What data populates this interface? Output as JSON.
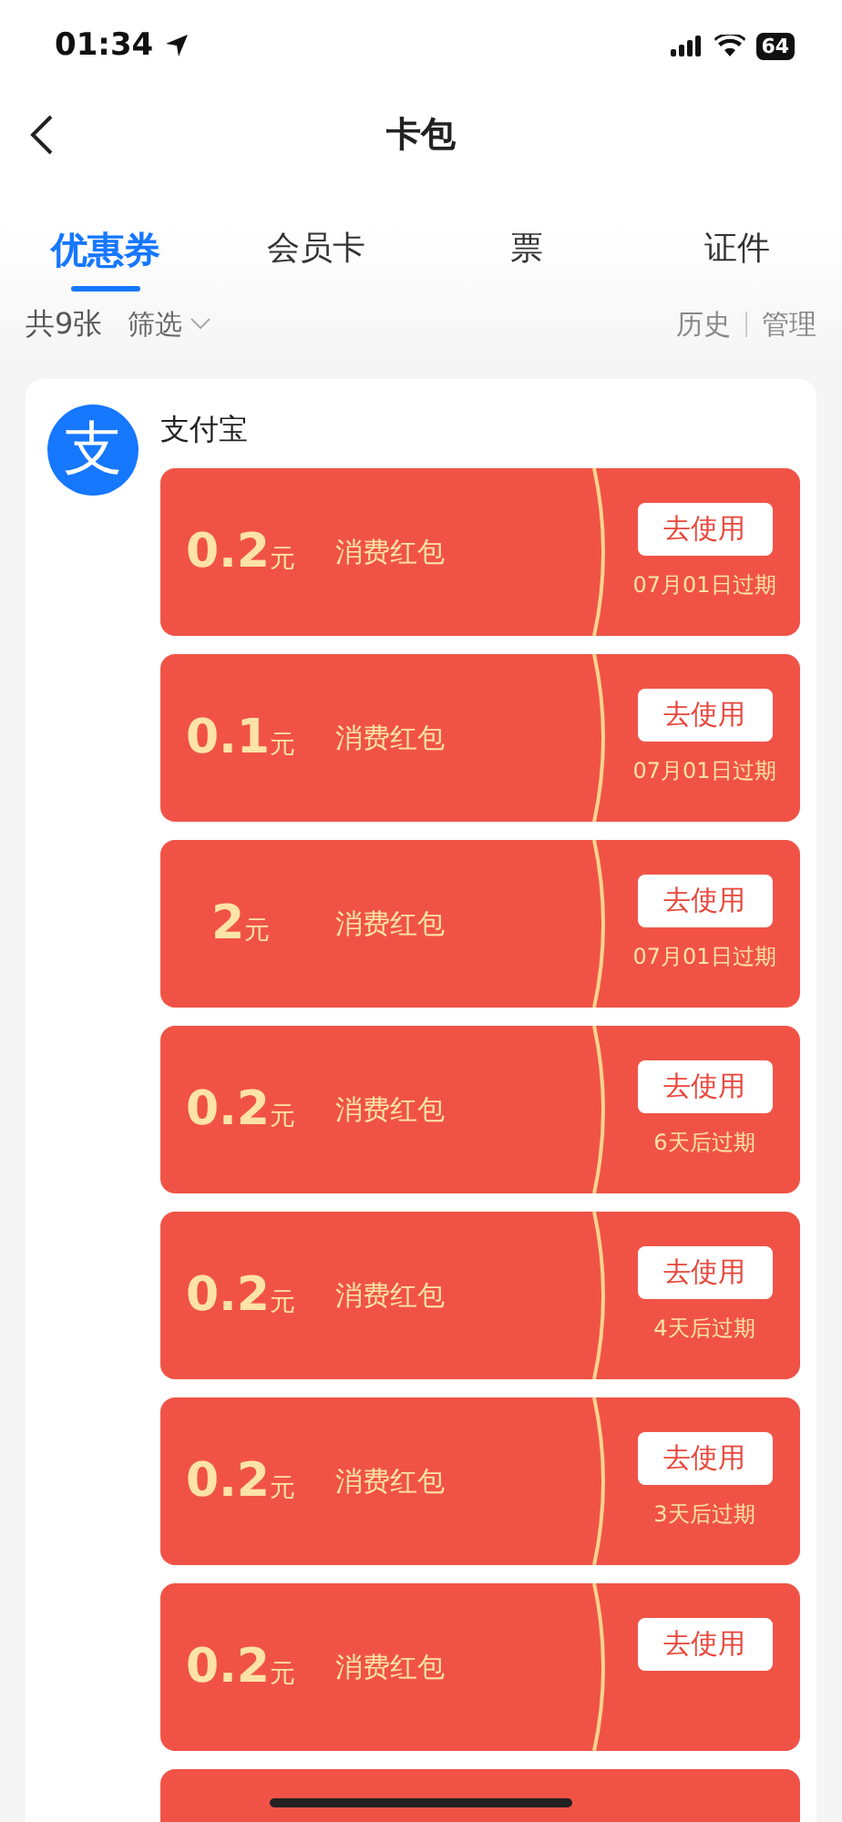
{
  "status_bar": {
    "time": "01:34",
    "battery": "64"
  },
  "header": {
    "title": "卡包"
  },
  "tabs": [
    {
      "label": "优惠券",
      "selected": true
    },
    {
      "label": "会员卡",
      "selected": false
    },
    {
      "label": "票",
      "selected": false
    },
    {
      "label": "证件",
      "selected": false
    }
  ],
  "toolbar": {
    "count": "共9张",
    "filter": "筛选",
    "history": "历史",
    "manage": "管理"
  },
  "group": {
    "name": "支付宝",
    "logo": "支",
    "coupons": [
      {
        "kind": "full",
        "amount": "0.2",
        "unit": "元",
        "name": "消费红包",
        "button": "去使用",
        "expiry": "07月01日过期"
      },
      {
        "kind": "full",
        "amount": "0.1",
        "unit": "元",
        "name": "消费红包",
        "button": "去使用",
        "expiry": "07月01日过期"
      },
      {
        "kind": "full",
        "amount": "2",
        "unit": "元",
        "name": "消费红包",
        "button": "去使用",
        "expiry": "07月01日过期"
      },
      {
        "kind": "full",
        "amount": "0.2",
        "unit": "元",
        "name": "消费红包",
        "button": "去使用",
        "expiry": "6天后过期"
      },
      {
        "kind": "full",
        "amount": "0.2",
        "unit": "元",
        "name": "消费红包",
        "button": "去使用",
        "expiry": "4天后过期"
      },
      {
        "kind": "full",
        "amount": "0.2",
        "unit": "元",
        "name": "消费红包",
        "button": "去使用",
        "expiry": "3天后过期"
      },
      {
        "kind": "full",
        "amount": "0.2",
        "unit": "元",
        "name": "消费红包",
        "button": "去使用"
      },
      {
        "kind": "blank"
      }
    ]
  }
}
